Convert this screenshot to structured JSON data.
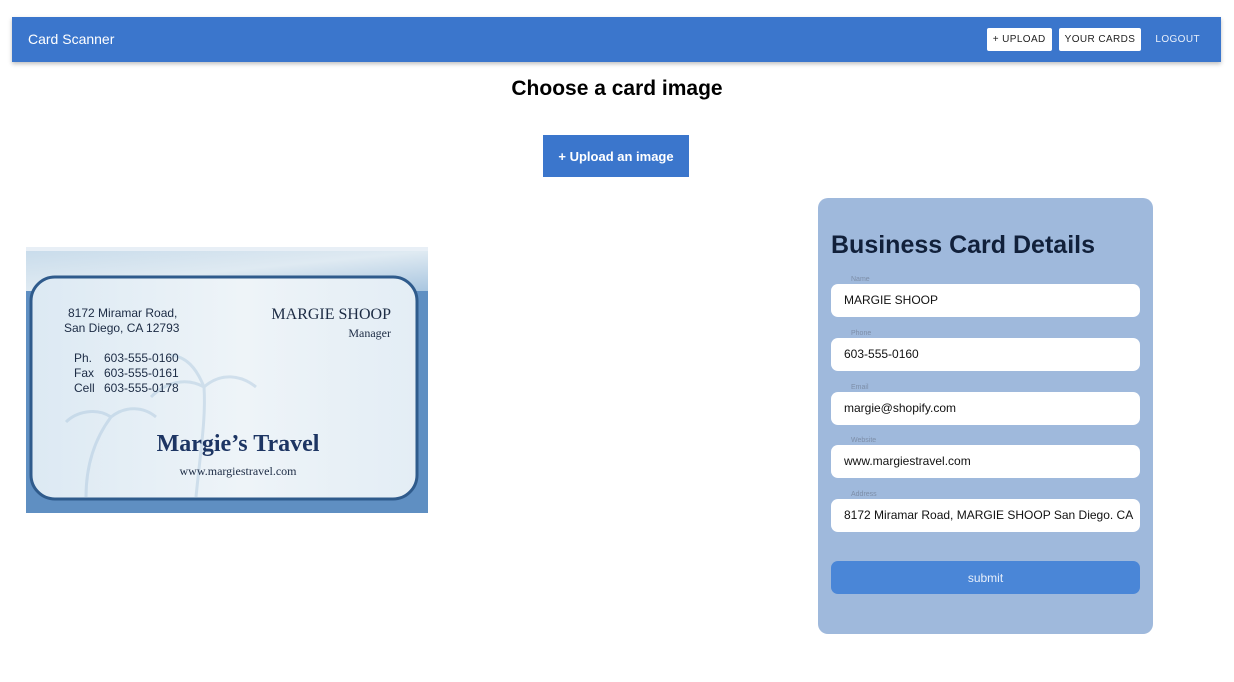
{
  "appbar": {
    "title": "Card Scanner",
    "upload_label": "+ UPLOAD",
    "your_cards_label": "YOUR CARDS",
    "logout_label": "LOGOUT",
    "color": "#3b76cc"
  },
  "main": {
    "heading": "Choose a card image",
    "upload_button_label": "+ Upload an image"
  },
  "card": {
    "address_line1": "8172 Miramar Road,",
    "address_line2": "San Diego, CA 12793",
    "name": "MARGIE SHOOP",
    "role": "Manager",
    "phone_label": "Ph.",
    "phone": "603-555-0160",
    "fax_label": "Fax",
    "fax": "603-555-0161",
    "cell_label": "Cell",
    "cell": "603-555-0178",
    "company": "Margie’s Travel",
    "website": "www.margiestravel.com"
  },
  "details": {
    "title": "Business Card Details",
    "fields": [
      {
        "label": "Name",
        "value": "MARGIE SHOOP"
      },
      {
        "label": "Phone",
        "value": "603-555-0160"
      },
      {
        "label": "Email",
        "value": "margie@shopify.com"
      },
      {
        "label": "Website",
        "value": "www.margiestravel.com"
      },
      {
        "label": "Address",
        "value": "8172 Miramar Road, MARGIE SHOOP San Diego. CA"
      }
    ],
    "submit_label": "submit",
    "panel_color": "#9fb9dc"
  }
}
